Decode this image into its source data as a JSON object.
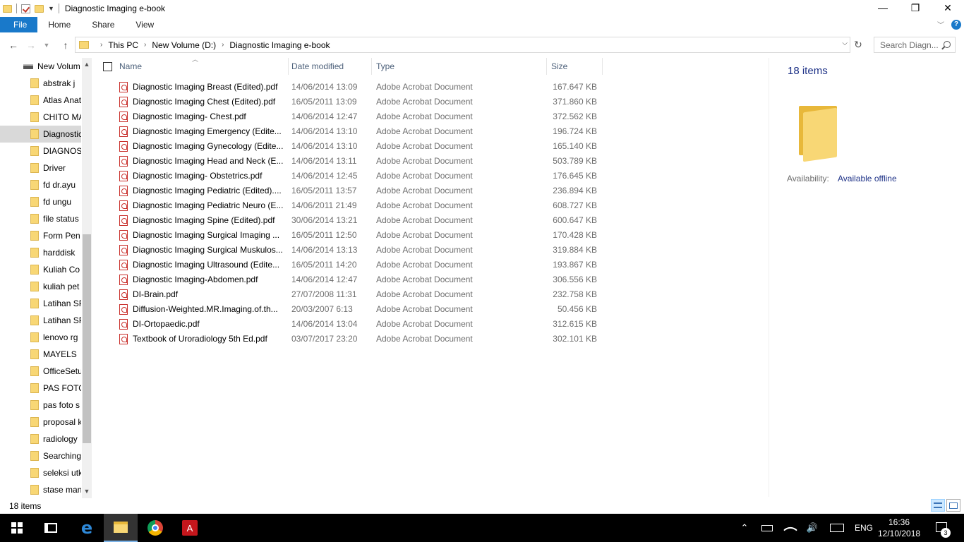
{
  "window": {
    "title": "Diagnostic Imaging e-book",
    "minimize_glyph": "—",
    "maximize_glyph": "❐",
    "close_glyph": "✕"
  },
  "ribbon": {
    "tabs": [
      "File",
      "Home",
      "Share",
      "View"
    ],
    "help_glyph": "?"
  },
  "address": {
    "crumbs": [
      "This PC",
      "New Volume (D:)",
      "Diagnostic Imaging e-book"
    ],
    "search_placeholder": "Search Diagn..."
  },
  "nav": {
    "drive_label": "New Volum",
    "folders": [
      "abstrak j",
      "Atlas Anat",
      "CHITO MA",
      "Diagnostic",
      "DIAGNOS",
      "Driver",
      "fd dr.ayu",
      "fd ungu",
      "file status",
      "Form Pen",
      "harddisk",
      "Kuliah Co",
      "kuliah pet",
      "Latihan SP",
      "Latihan SP",
      "lenovo rg",
      "MAYELS",
      "OfficeSetu",
      "PAS FOTO",
      "pas foto s",
      "proposal k",
      "radiology",
      "Searching",
      "seleksi utk",
      "stase man"
    ],
    "selected_index": 3
  },
  "columns": {
    "name": "Name",
    "date": "Date modified",
    "type": "Type",
    "size": "Size"
  },
  "files": [
    {
      "name": "Diagnostic Imaging Breast (Edited).pdf",
      "date": "14/06/2014 13:09",
      "type": "Adobe Acrobat Document",
      "size": "167.647 KB"
    },
    {
      "name": "Diagnostic Imaging Chest (Edited).pdf",
      "date": "16/05/2011 13:09",
      "type": "Adobe Acrobat Document",
      "size": "371.860 KB"
    },
    {
      "name": "Diagnostic Imaging- Chest.pdf",
      "date": "14/06/2014 12:47",
      "type": "Adobe Acrobat Document",
      "size": "372.562 KB"
    },
    {
      "name": "Diagnostic Imaging Emergency (Edite...",
      "date": "14/06/2014 13:10",
      "type": "Adobe Acrobat Document",
      "size": "196.724 KB"
    },
    {
      "name": "Diagnostic Imaging Gynecology (Edite...",
      "date": "14/06/2014 13:10",
      "type": "Adobe Acrobat Document",
      "size": "165.140 KB"
    },
    {
      "name": "Diagnostic Imaging Head and Neck (E...",
      "date": "14/06/2014 13:11",
      "type": "Adobe Acrobat Document",
      "size": "503.789 KB"
    },
    {
      "name": "Diagnostic Imaging- Obstetrics.pdf",
      "date": "14/06/2014 12:45",
      "type": "Adobe Acrobat Document",
      "size": "176.645 KB"
    },
    {
      "name": "Diagnostic Imaging Pediatric (Edited)....",
      "date": "16/05/2011 13:57",
      "type": "Adobe Acrobat Document",
      "size": "236.894 KB"
    },
    {
      "name": "Diagnostic Imaging Pediatric Neuro (E...",
      "date": "14/06/2011 21:49",
      "type": "Adobe Acrobat Document",
      "size": "608.727 KB"
    },
    {
      "name": "Diagnostic Imaging Spine (Edited).pdf",
      "date": "30/06/2014 13:21",
      "type": "Adobe Acrobat Document",
      "size": "600.647 KB"
    },
    {
      "name": "Diagnostic Imaging Surgical Imaging ...",
      "date": "16/05/2011 12:50",
      "type": "Adobe Acrobat Document",
      "size": "170.428 KB"
    },
    {
      "name": "Diagnostic Imaging Surgical Muskulos...",
      "date": "14/06/2014 13:13",
      "type": "Adobe Acrobat Document",
      "size": "319.884 KB"
    },
    {
      "name": "Diagnostic Imaging Ultrasound (Edite...",
      "date": "16/05/2011 14:20",
      "type": "Adobe Acrobat Document",
      "size": "193.867 KB"
    },
    {
      "name": "Diagnostic Imaging-Abdomen.pdf",
      "date": "14/06/2014 12:47",
      "type": "Adobe Acrobat Document",
      "size": "306.556 KB"
    },
    {
      "name": "DI-Brain.pdf",
      "date": "27/07/2008 11:31",
      "type": "Adobe Acrobat Document",
      "size": "232.758 KB"
    },
    {
      "name": "Diffusion-Weighted.MR.Imaging.of.th...",
      "date": "20/03/2007 6:13",
      "type": "Adobe Acrobat Document",
      "size": "50.456 KB"
    },
    {
      "name": "DI-Ortopaedic.pdf",
      "date": "14/06/2014 13:04",
      "type": "Adobe Acrobat Document",
      "size": "312.615 KB"
    },
    {
      "name": "Textbook of Uroradiology 5th Ed.pdf",
      "date": "03/07/2017 23:20",
      "type": "Adobe Acrobat Document",
      "size": "302.101 KB"
    }
  ],
  "details": {
    "count": "18 items",
    "availability_label": "Availability:",
    "availability_value": "Available offline"
  },
  "status": {
    "count": "18 items"
  },
  "taskbar": {
    "language": "ENG",
    "time": "16:36",
    "date": "12/10/2018",
    "notification_count": "3",
    "edge_glyph": "e",
    "acrobat_glyph": "A",
    "tray_up": "⌃",
    "volume_glyph": "🔊"
  },
  "colors": {
    "accent": "#1979ca",
    "header_text": "#4c607a",
    "folder": "#f8d775",
    "pdf_red": "#c9302c"
  }
}
